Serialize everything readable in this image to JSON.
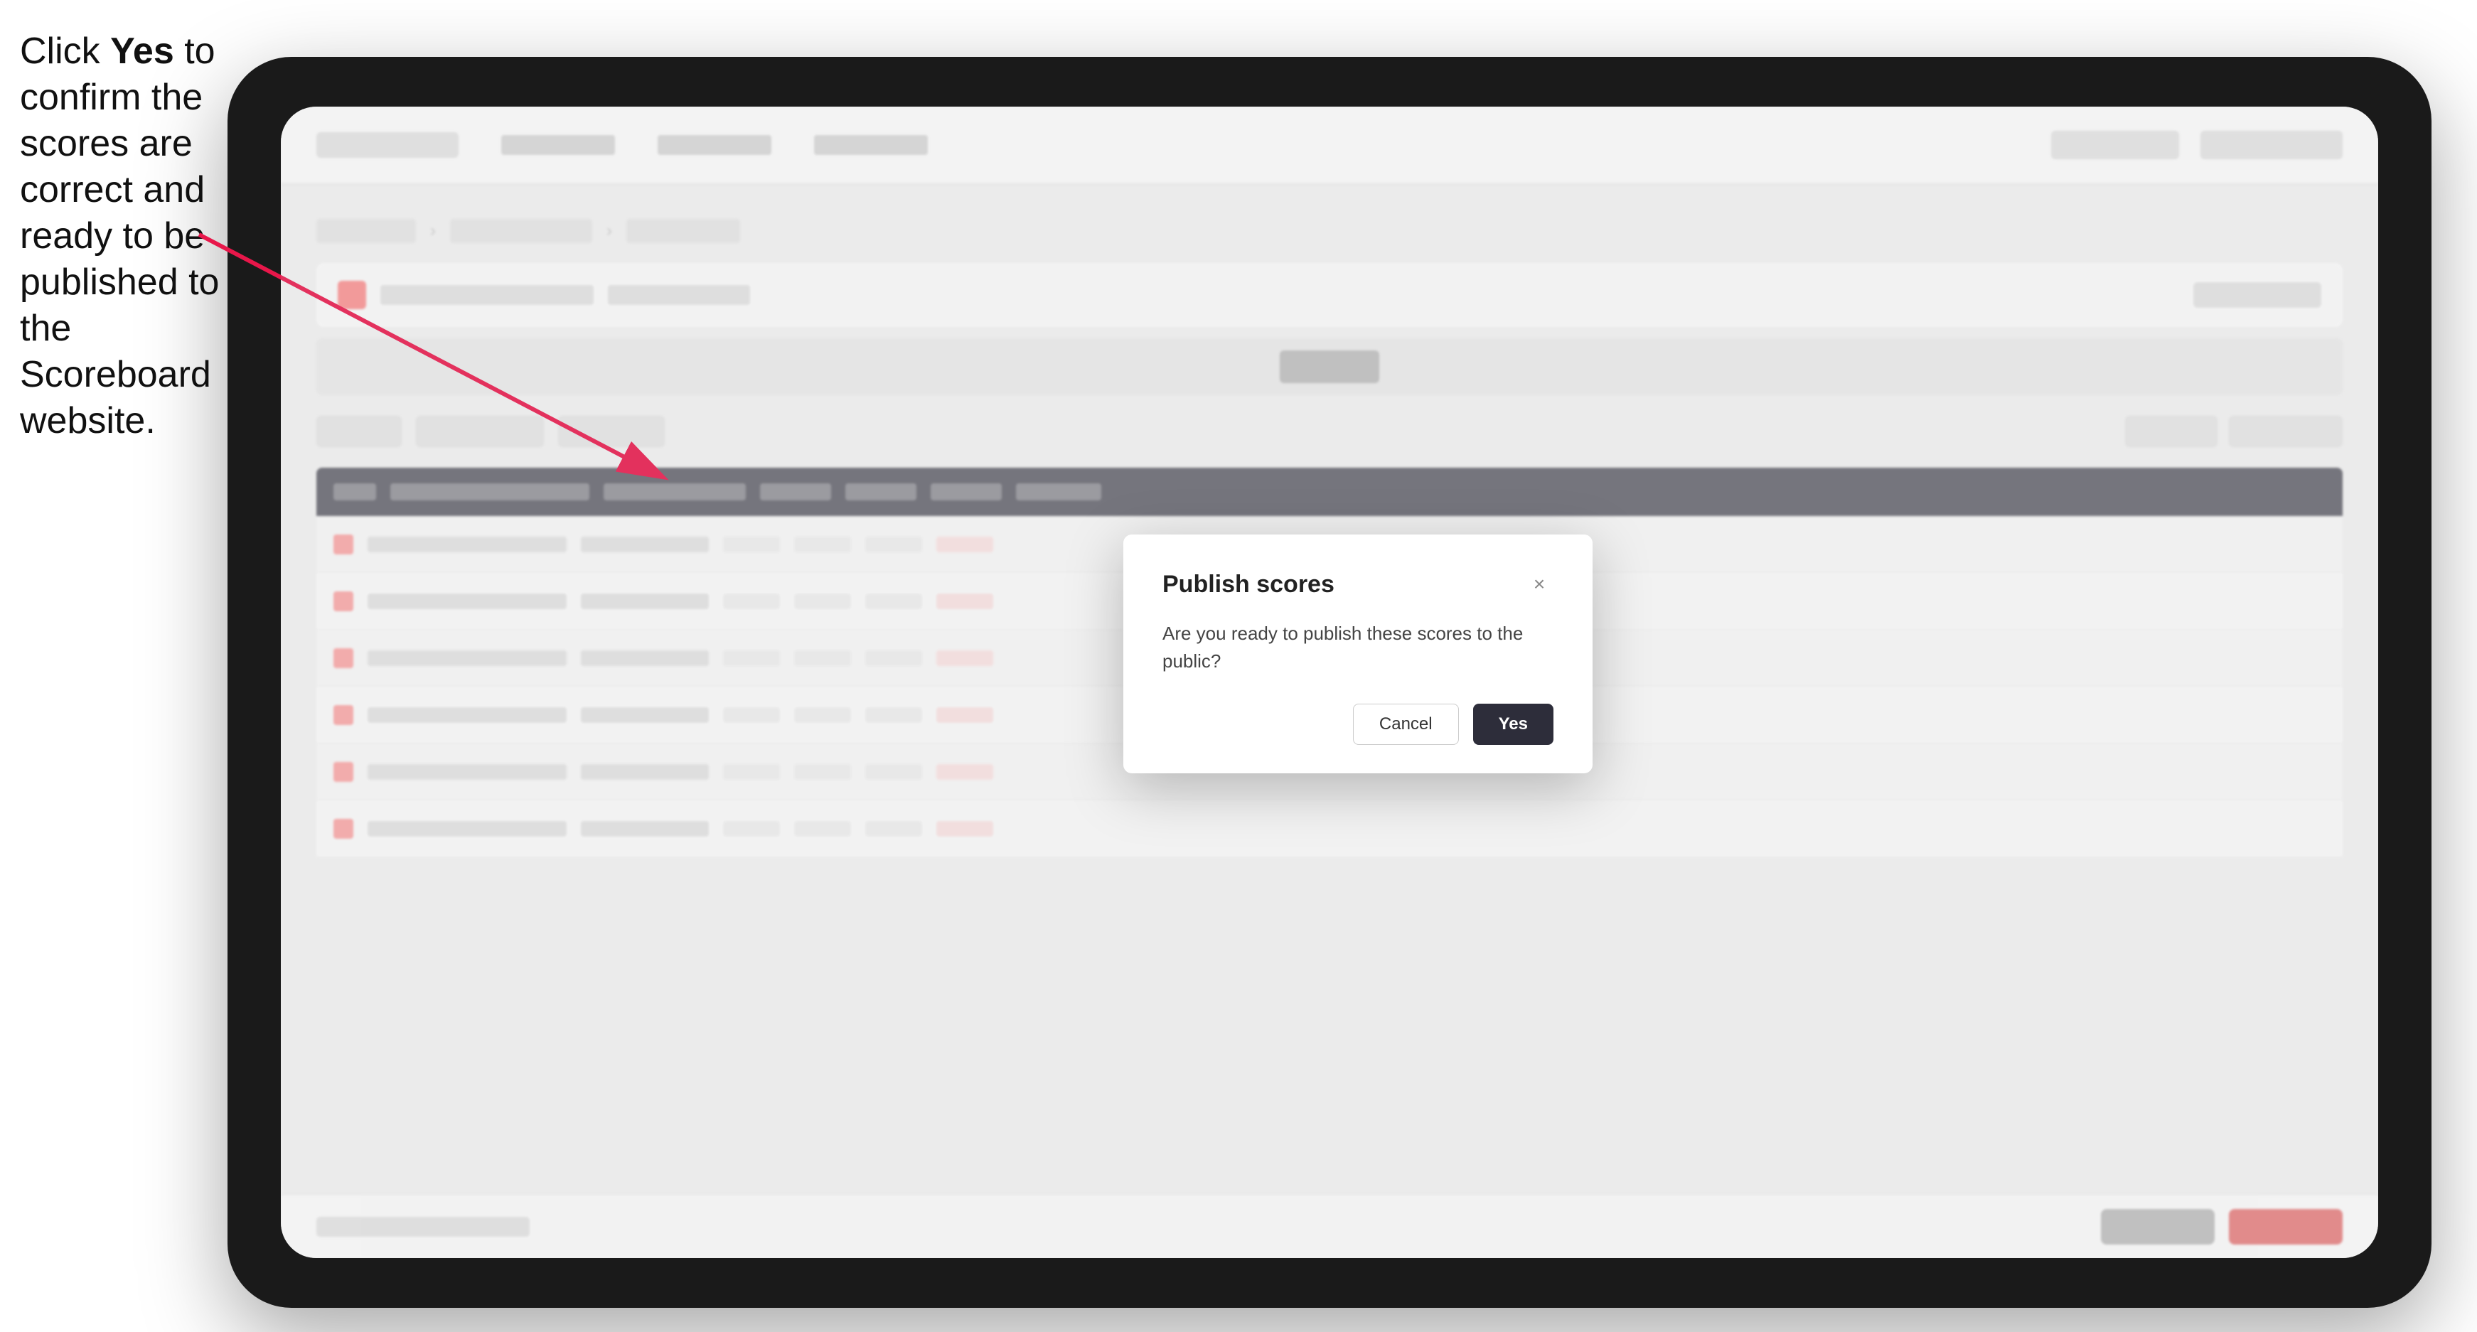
{
  "instruction": {
    "text_part1": "Click ",
    "bold": "Yes",
    "text_part2": " to confirm the scores are correct and ready to be published to the Scoreboard website."
  },
  "modal": {
    "title": "Publish scores",
    "body_text": "Are you ready to publish these scores to the public?",
    "cancel_label": "Cancel",
    "yes_label": "Yes",
    "close_icon": "×"
  },
  "app": {
    "nav_logo": "",
    "table": {
      "rows": 6
    }
  }
}
